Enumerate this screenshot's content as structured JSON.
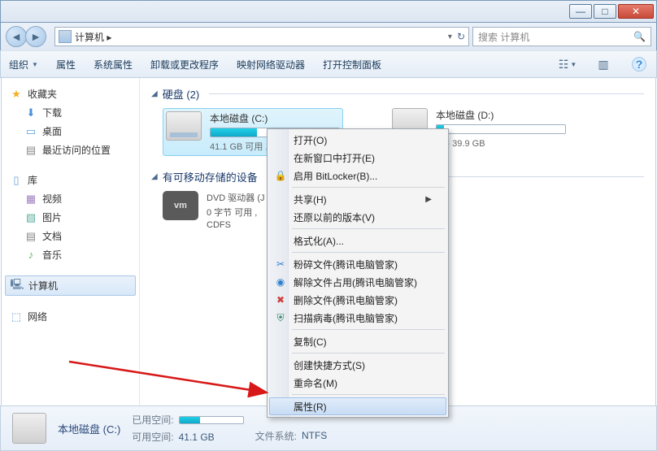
{
  "titlebar": {
    "min": "—",
    "max": "□",
    "close": "✕"
  },
  "address": {
    "path": "计算机 ▸",
    "refresh": "↻"
  },
  "search": {
    "placeholder": "搜索 计算机",
    "icon": "🔍"
  },
  "toolbar": {
    "organize": "组织",
    "properties": "属性",
    "sysprops": "系统属性",
    "uninstall": "卸载或更改程序",
    "mapdrive": "映射网络驱动器",
    "ctrlpanel": "打开控制面板"
  },
  "sidebar": {
    "favorites": "收藏夹",
    "downloads": "下载",
    "desktop": "桌面",
    "recent": "最近访问的位置",
    "libraries": "库",
    "videos": "视频",
    "pictures": "图片",
    "documents": "文档",
    "music": "音乐",
    "computer": "计算机",
    "network": "网络"
  },
  "groups": {
    "hdd": "硬盘 (2)",
    "removable": "有可移动存储的设备"
  },
  "drives": {
    "c": {
      "name": "本地磁盘 (C:)",
      "stat": "41.1 GB 可用 ,"
    },
    "d": {
      "name": "本地磁盘 (D:)",
      "stat": ", 共 39.9 GB"
    }
  },
  "device": {
    "name": "DVD 驱动器 (J",
    "stat": "0 字节 可用 , ",
    "fs": "CDFS",
    "badge": "vm"
  },
  "ctx": {
    "open": "打开(O)",
    "newwin": "在新窗口中打开(E)",
    "bitlocker": "启用 BitLocker(B)...",
    "share": "共享(H)",
    "restore": "还原以前的版本(V)",
    "format": "格式化(A)...",
    "shred": "粉碎文件(腾讯电脑管家)",
    "unlock": "解除文件占用(腾讯电脑管家)",
    "delete": "删除文件(腾讯电脑管家)",
    "scan": "扫描病毒(腾讯电脑管家)",
    "copy": "复制(C)",
    "shortcut": "创建快捷方式(S)",
    "rename": "重命名(M)",
    "props": "属性(R)"
  },
  "status": {
    "title": "本地磁盘 (C:)",
    "usedlab": "已用空间:",
    "freelab": "可用空间:",
    "free": "41.1 GB",
    "fslab": "文件系统:",
    "fs": "NTFS"
  }
}
